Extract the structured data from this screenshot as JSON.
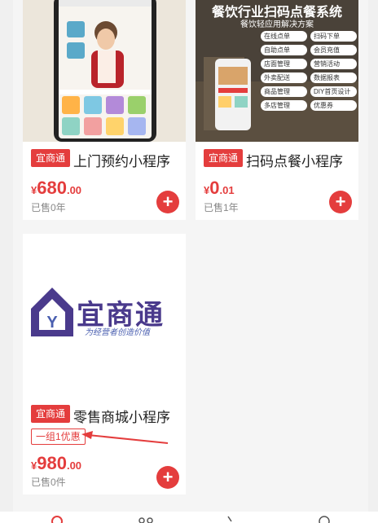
{
  "cards": [
    {
      "tag": "宜商通",
      "title": "上门预约小程序",
      "price_currency": "¥",
      "price_int": "680",
      "price_dec": ".00",
      "sold": "已售0年",
      "add_label": "+"
    },
    {
      "tag": "宜商通",
      "title": "扫码点餐小程序",
      "price_currency": "¥",
      "price_int": "0",
      "price_dec": ".01",
      "sold": "已售1年",
      "add_label": "+",
      "banner_title": "餐饮行业扫码点餐系统",
      "banner_subtitle": "餐饮轻应用解决方案",
      "features": [
        "在线点单",
        "扫码下单",
        "自助点单",
        "会员充值",
        "店面管理",
        "营销活动",
        "外卖配送",
        "数据报表",
        "商品管理",
        "DIY首页设计",
        "多店管理",
        "优惠券"
      ]
    },
    {
      "tag": "宜商通",
      "title": "零售商城小程序",
      "ribbon": "一组1优惠",
      "price_currency": "¥",
      "price_int": "980",
      "price_dec": ".00",
      "sold": "已售0件",
      "add_label": "+",
      "logo_text": "宜商通",
      "logo_slogan": "为经营者创造价值"
    }
  ],
  "colors": {
    "accent": "#e43d3d",
    "logo_purple": "#4a3a8c",
    "logo_blue": "#4a5fb0"
  }
}
